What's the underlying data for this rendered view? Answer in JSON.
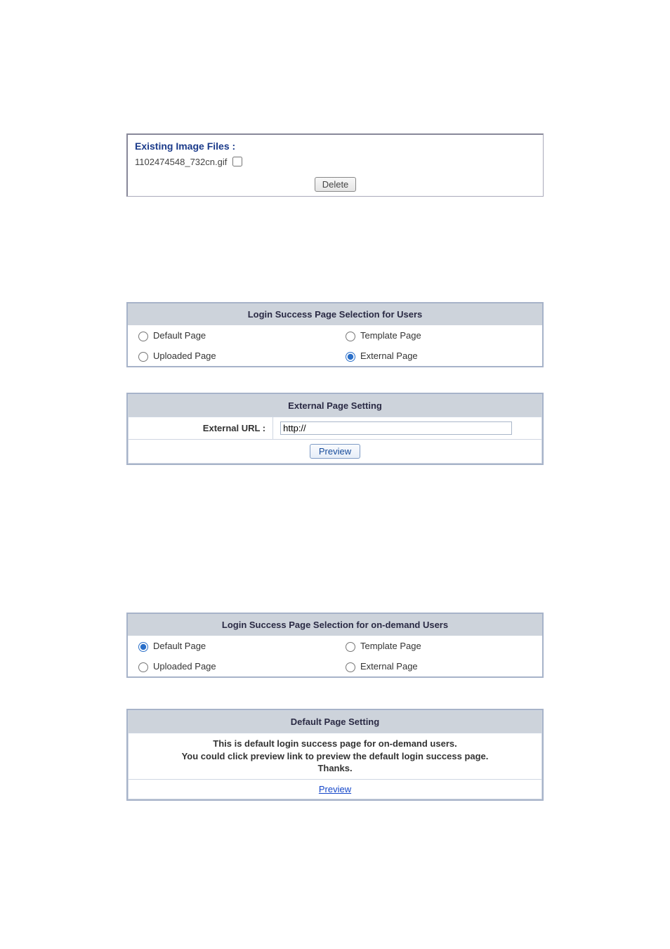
{
  "existingFiles": {
    "title": "Existing Image Files :",
    "files": [
      "1102474548_732cn.gif"
    ],
    "deleteLabel": "Delete"
  },
  "usersSelection": {
    "header": "Login Success Page Selection for Users",
    "options": {
      "default": "Default Page",
      "template": "Template Page",
      "uploaded": "Uploaded Page",
      "external": "External Page"
    },
    "selected": "external"
  },
  "externalPage": {
    "header": "External Page Setting",
    "label": "External URL :",
    "value": "http://",
    "previewLabel": "Preview"
  },
  "ondemandSelection": {
    "header": "Login Success Page Selection for on-demand Users",
    "options": {
      "default": "Default Page",
      "template": "Template Page",
      "uploaded": "Uploaded Page",
      "external": "External Page"
    },
    "selected": "default"
  },
  "defaultPage": {
    "header": "Default Page Setting",
    "msg1": "This is default login success page for on-demand users.",
    "msg2": "You could click preview link to preview the default login success page.",
    "msg3": "Thanks.",
    "previewLabel": "Preview"
  }
}
